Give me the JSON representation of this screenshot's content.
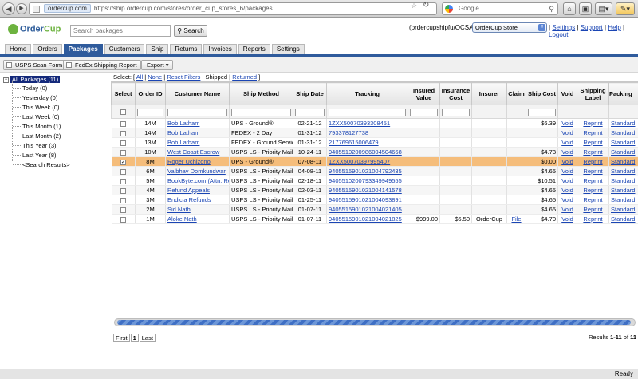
{
  "browser": {
    "domain": "ordercup.com",
    "url_rest": "https://ship.ordercup.com/stores/order_cup_stores_6/packages",
    "search_placeholder": "Google",
    "status": "Ready"
  },
  "app": {
    "logo_order": "Order",
    "logo_cup": "Cup",
    "search_placeholder": "Search packages",
    "search_button": "Search",
    "account": "(ordercupshipfu/OCSA1)",
    "store": "OrderCup Store",
    "links": [
      "Settings",
      "Support",
      "Help",
      "Logout"
    ]
  },
  "tabs": [
    "Home",
    "Orders",
    "Packages",
    "Customers",
    "Ship",
    "Returns",
    "Invoices",
    "Reports",
    "Settings"
  ],
  "active_tab": "Packages",
  "toolbar": {
    "usps": "USPS Scan Form",
    "fedex": "FedEx Shipping Report",
    "export": "Export ▾"
  },
  "tree": {
    "root": "All Packages (11)",
    "children": [
      "Today (0)",
      "Yesterday (0)",
      "This Week (0)",
      "Last Week (0)",
      "This Month (1)",
      "Last Month (2)",
      "This Year (3)",
      "Last Year (8)",
      "<Search Results>"
    ]
  },
  "filters": {
    "label": "Select: [",
    "all": "All",
    "none": "None",
    "reset": "Reset Filters",
    "shipped": "Shipped",
    "returned": "Returned",
    "close": "]"
  },
  "columns": [
    "Select",
    "Order ID",
    "Customer Name",
    "Ship Method",
    "Ship Date",
    "Tracking",
    "Insured Value",
    "Insurance Cost",
    "Insurer",
    "Claim",
    "Ship Cost",
    "Void",
    "Shipping Label",
    "Packing"
  ],
  "rows": [
    {
      "checked": false,
      "order": "14M",
      "customer": "Bob Latham",
      "method": "UPS - Ground®",
      "date": "02-21-12",
      "tracking": "1ZXX50070393308451",
      "insured": "",
      "ins_cost": "",
      "insurer": "",
      "claim": "",
      "cost": "$6.39",
      "void": "Void",
      "label": "Reprint",
      "packing": "Standard"
    },
    {
      "checked": false,
      "order": "14M",
      "customer": "Bob Latham",
      "method": "FEDEX - 2 Day",
      "date": "01-31-12",
      "tracking": "793378127738",
      "insured": "",
      "ins_cost": "",
      "insurer": "",
      "claim": "",
      "cost": "",
      "void": "Void",
      "label": "Reprint",
      "packing": "Standard"
    },
    {
      "checked": false,
      "order": "13M",
      "customer": "Bob Latham",
      "method": "FEDEX - Ground Service",
      "date": "01-31-12",
      "tracking": "217769615006479",
      "insured": "",
      "ins_cost": "",
      "insurer": "",
      "claim": "",
      "cost": "",
      "void": "Void",
      "label": "Reprint",
      "packing": "Standard"
    },
    {
      "checked": false,
      "order": "10M",
      "customer": "West Coast Escrow",
      "method": "USPS LS - Priority Mail",
      "date": "10-24-11",
      "tracking": "9405510200986004504668",
      "insured": "",
      "ins_cost": "",
      "insurer": "",
      "claim": "",
      "cost": "$4.73",
      "void": "Void",
      "label": "Reprint",
      "packing": "Standard"
    },
    {
      "checked": true,
      "order": "8M",
      "customer": "Roger Uchizono",
      "method": "UPS - Ground®",
      "date": "07-08-11",
      "tracking": "1ZXX50070397995407",
      "insured": "",
      "ins_cost": "",
      "insurer": "",
      "claim": "",
      "cost": "$0.00",
      "void": "Void",
      "label": "Reprint",
      "packing": "Standard"
    },
    {
      "checked": false,
      "order": "6M",
      "customer": "Vaibhav Domkundwar",
      "method": "USPS LS - Priority Mail",
      "date": "04-08-11",
      "tracking": "9405515901021004792435",
      "insured": "",
      "ins_cost": "",
      "insurer": "",
      "claim": "",
      "cost": "$4.65",
      "void": "Void",
      "label": "Reprint",
      "packing": "Standard"
    },
    {
      "checked": false,
      "order": "5M",
      "customer": "BookByte.com (Attn: Ret",
      "method": "USPS LS - Priority Mail",
      "date": "02-18-11",
      "tracking": "9405510200793349949555",
      "insured": "",
      "ins_cost": "",
      "insurer": "",
      "claim": "",
      "cost": "$10.51",
      "void": "Void",
      "label": "Reprint",
      "packing": "Standard"
    },
    {
      "checked": false,
      "order": "4M",
      "customer": "Refund Appeals",
      "method": "USPS LS - Priority Mail",
      "date": "02-03-11",
      "tracking": "9405515901021004141578",
      "insured": "",
      "ins_cost": "",
      "insurer": "",
      "claim": "",
      "cost": "$4.65",
      "void": "Void",
      "label": "Reprint",
      "packing": "Standard"
    },
    {
      "checked": false,
      "order": "3M",
      "customer": "Endicia Refunds",
      "method": "USPS LS - Priority Mail",
      "date": "01-25-11",
      "tracking": "9405515901021004093891",
      "insured": "",
      "ins_cost": "",
      "insurer": "",
      "claim": "",
      "cost": "$4.65",
      "void": "Void",
      "label": "Reprint",
      "packing": "Standard"
    },
    {
      "checked": false,
      "order": "2M",
      "customer": "Sid Nath",
      "method": "USPS LS - Priority Mail",
      "date": "01-07-11",
      "tracking": "9405515901021004021405",
      "insured": "",
      "ins_cost": "",
      "insurer": "",
      "claim": "",
      "cost": "$4.65",
      "void": "Void",
      "label": "Reprint",
      "packing": "Standard"
    },
    {
      "checked": false,
      "order": "1M",
      "customer": "Aloke Nath",
      "method": "USPS LS - Priority Mail",
      "date": "01-07-11",
      "tracking": "9405515901021004021825",
      "insured": "$999.00",
      "ins_cost": "$6.50",
      "insurer": "OrderCup",
      "claim": "File",
      "cost": "$4.70",
      "void": "Void",
      "label": "Reprint",
      "packing": "Standard"
    }
  ],
  "pager": {
    "first": "First",
    "page": "1",
    "last": "Last"
  },
  "results": {
    "prefix": "Results ",
    "range": "1-11",
    "middle": " of ",
    "total": "11"
  },
  "colors": {
    "accent": "#2f5b9c",
    "selected_row": "#f5bd7b",
    "link": "#1a45b4"
  }
}
